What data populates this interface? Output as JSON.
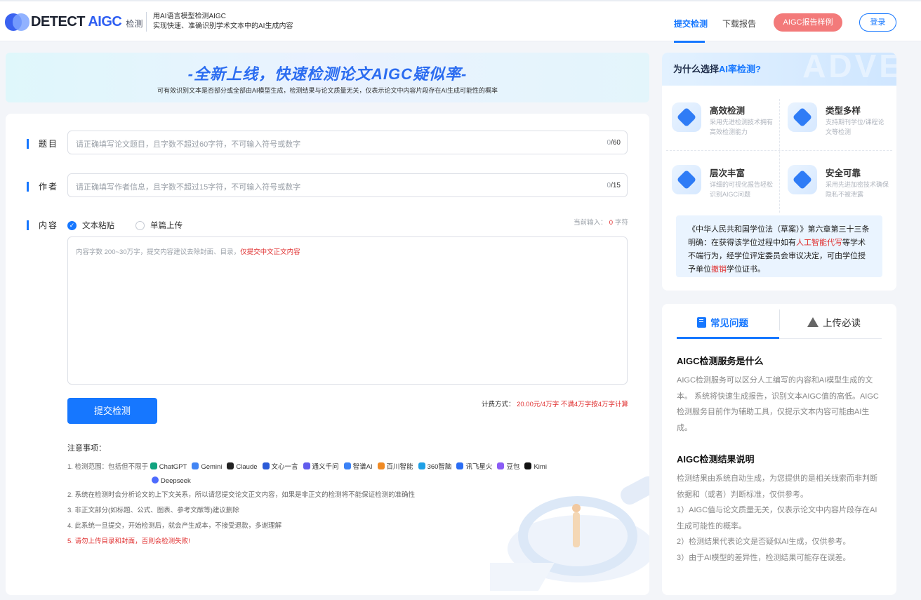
{
  "header": {
    "logo_detect": "DETECT",
    "logo_aigc": "AIGC",
    "logo_sub": "检测",
    "slogan_line1": "用AI语言模型检测AIGC",
    "slogan_line2": "实现快速、准确识别学术文本中的AI生成内容",
    "nav_submit": "提交检测",
    "nav_download": "下载报告",
    "sample_button": "AIGC报告样例",
    "login_button": "登录",
    "accent_color": "#1677ff",
    "sample_color": "#f37a7a"
  },
  "banner": {
    "title": "-全新上线，快速检测论文AIGC疑似率-",
    "subtitle": "可有效识别文本是否部分或全部由AI模型生成，检测结果与论文质量无关，仅表示论文中内容片段存在AI生成可能性的概率"
  },
  "form": {
    "title_label": "题目",
    "title_placeholder": "请正确填写论文题目，且字数不超过60字符，不可输入符号或数字",
    "title_count": "0",
    "title_max": "/60",
    "author_label": "作者",
    "author_placeholder": "请正确填写作者信息，且字数不超过15字符，不可输入符号或数字",
    "author_count": "0",
    "author_max": "/15",
    "content_label": "内容",
    "option_paste": "文本粘贴",
    "option_upload": "单篇上传",
    "current_input_label": "当前输入：",
    "current_input_value": "0",
    "current_input_unit": "字符",
    "content_placeholder": "内容字数 200~30万字，提交内容建议去除封面、目录，",
    "content_placeholder_red": "仅提交中文正文内容",
    "submit_button": "提交检测",
    "fee_label": "计费方式：",
    "fee_value": "20.00元/4万字 不满4万字按4万字计算"
  },
  "notes": {
    "title": "注意事项：",
    "item1_prefix": "1. 检测范围：包括但不限于",
    "ai_models": [
      {
        "name": "ChatGPT",
        "color": "#10a37f"
      },
      {
        "name": "Gemini",
        "color": "#4285f4"
      },
      {
        "name": "Claude",
        "color": "#222222"
      },
      {
        "name": "文心一言",
        "color": "#2b5bd7"
      },
      {
        "name": "通义千问",
        "color": "#615ced"
      },
      {
        "name": "智谱AI",
        "color": "#3b82f6"
      },
      {
        "name": "百川智能",
        "color": "#f08a24"
      },
      {
        "name": "360智脑",
        "color": "#1fa0e6"
      },
      {
        "name": "讯飞星火",
        "color": "#2a6df4"
      },
      {
        "name": "豆包",
        "color": "#8b5cf6"
      },
      {
        "name": "Kimi",
        "color": "#111111"
      }
    ],
    "deepseek": "Deepseek",
    "deepseek_color": "#4d6bfe",
    "item2": "2. 系统在检测时会分析论文的上下文关系，所以请您提交论文正文内容，如果是非正文的检测将不能保证检测的准确性",
    "item3": "3. 非正文部分(如标题、公式、图表、参考文献等)建议删除",
    "item4": "4. 此系统一旦提交，开始检测后，就会产生成本，不接受退款，多谢理解",
    "item5": "5. 请勿上传目录和封面，否则会检测失败!"
  },
  "why": {
    "title_prefix": "为什么选择",
    "title_highlight": "AI率检测?",
    "watermark": "ADVE",
    "features": [
      {
        "title": "高效检测",
        "desc": "采用先进检测技术拥有高效检测能力",
        "icon": "location-shield-icon"
      },
      {
        "title": "类型多样",
        "desc": "支持期刊学位/课程论文等检测",
        "icon": "cubes-icon"
      },
      {
        "title": "层次丰富",
        "desc": "详细的可视化报告轻松识别AIGC问题",
        "icon": "shield-icon"
      },
      {
        "title": "安全可靠",
        "desc": "采用先进加密技术确保隐私不被泄露",
        "icon": "secure-plus-icon"
      }
    ],
    "law_part1": "《中华人民共和国学位法（草案）》第六章第三十三条明确：在获得该学位过程中如有",
    "law_red1": "人工智能代写",
    "law_part2": "等学术不端行为，经学位评定委员会审议决定，可由学位授予单位",
    "law_red2": "撤销",
    "law_part3": "学位证书。"
  },
  "faq": {
    "tab_faq": "常见问题",
    "tab_notice": "上传必读",
    "q1": "AIGC检测服务是什么",
    "a1": "AIGC检测服务可以区分人工编写的内容和AI模型生成的文本。 系统将快速生成报告，识别文本AIGC值的高低。AIGC检测服务目前作为辅助工具，仅提示文本内容可能由AI生成。",
    "q2": "AIGC检测结果说明",
    "a2_intro": "检测结果由系统自动生成，为您提供的是相关线索而非判断依据和（或者）判断标准，仅供参考。",
    "a2_1": "1）AIGC值与论文质量无关，仅表示论文中内容片段存在AI生成可能性的概率。",
    "a2_2": "2）检测结果代表论文是否疑似AI生成，仅供参考。",
    "a2_3": "3）由于AI模型的差异性，检测结果可能存在误差。"
  }
}
